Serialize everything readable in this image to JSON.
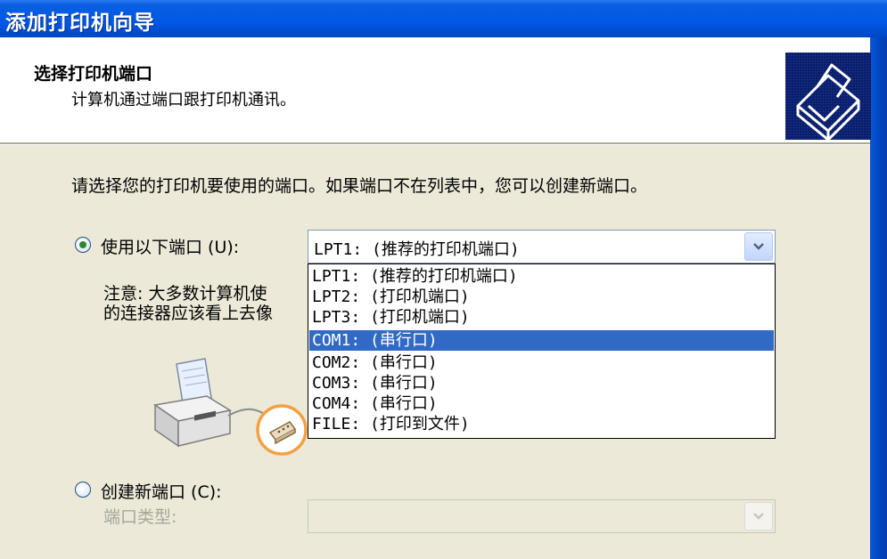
{
  "window": {
    "title": "添加打印机向导"
  },
  "header": {
    "title": "选择打印机端口",
    "subtitle": "计算机通过端口跟打印机通讯。",
    "icon": "printer-icon"
  },
  "instruction": "请选择您的打印机要使用的端口。如果端口不在列表中，您可以创建新端口。",
  "use_port": {
    "label": "使用以下端口 (U):",
    "selected": true,
    "dropdown_value": "LPT1:  (推荐的打印机端口)",
    "options": [
      "LPT1:  (推荐的打印机端口)",
      "LPT2:  (打印机端口)",
      "LPT3:  (打印机端口)",
      "COM1:  (串行口)",
      "COM2:  (串行口)",
      "COM3:  (串行口)",
      "COM4:  (串行口)",
      "FILE:  (打印到文件)"
    ],
    "highlighted_option": "COM1:  (串行口)"
  },
  "note": {
    "line1": "注意: 大多数计算机使",
    "line2": "的连接器应该看上去像"
  },
  "create_port": {
    "label": "创建新端口 (C):",
    "selected": false,
    "type_label": "端口类型:",
    "type_value": ""
  },
  "colors": {
    "titlebar": "#0058e6",
    "selection": "#316ac5",
    "dialog_bg": "#ece9d8",
    "connector_highlight": "#f5a040"
  }
}
